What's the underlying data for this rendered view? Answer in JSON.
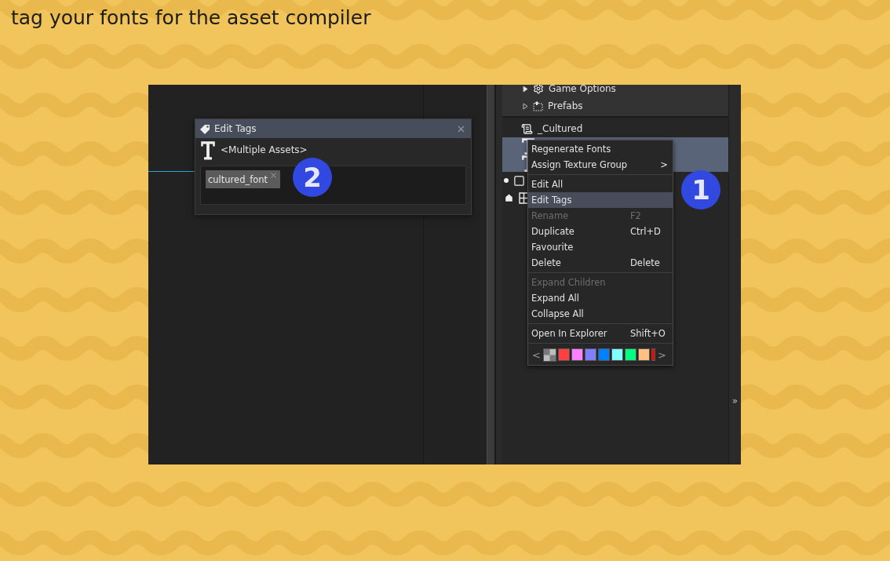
{
  "heading": "tag your fonts for the asset compiler",
  "tree": {
    "folders": [
      {
        "label": "Game Options",
        "expanded": false,
        "kind": "solid"
      },
      {
        "label": "Prefabs",
        "expanded": false,
        "kind": "outline"
      }
    ],
    "rows": [
      {
        "kind": "script",
        "label": "_Cultured",
        "selected": false
      },
      {
        "kind": "font",
        "selected": true
      },
      {
        "kind": "font",
        "selected": true
      },
      {
        "kind": "object",
        "selected": false
      },
      {
        "kind": "room",
        "selected": false
      }
    ]
  },
  "side_toggle": "»",
  "context_menu": {
    "items": [
      {
        "kind": "item",
        "label": "Regenerate Fonts",
        "disabled": false,
        "selected": false
      },
      {
        "kind": "item",
        "label": "Assign Texture Group",
        "submenu_arrow": ">",
        "disabled": false,
        "selected": false
      },
      {
        "kind": "separator"
      },
      {
        "kind": "item",
        "label": "Edit All",
        "disabled": false,
        "selected": false
      },
      {
        "kind": "item",
        "label": "Edit Tags",
        "disabled": false,
        "selected": true
      },
      {
        "kind": "item",
        "label": "Rename",
        "shortcut": "F2",
        "disabled": true,
        "selected": false
      },
      {
        "kind": "item",
        "label": "Duplicate",
        "shortcut": "Ctrl+D",
        "disabled": false,
        "selected": false
      },
      {
        "kind": "item",
        "label": "Favourite",
        "disabled": false,
        "selected": false
      },
      {
        "kind": "item",
        "label": "Delete",
        "shortcut": "Delete",
        "disabled": false,
        "selected": false
      },
      {
        "kind": "separator"
      },
      {
        "kind": "item",
        "label": "Expand Children",
        "disabled": true,
        "selected": false
      },
      {
        "kind": "item",
        "label": "Expand All",
        "disabled": false,
        "selected": false
      },
      {
        "kind": "item",
        "label": "Collapse All",
        "disabled": false,
        "selected": false
      },
      {
        "kind": "separator"
      },
      {
        "kind": "item",
        "label": "Open In Explorer",
        "shortcut": "Shift+O",
        "disabled": false,
        "selected": false
      },
      {
        "kind": "separator"
      },
      {
        "kind": "swatches",
        "prev": "<",
        "next": ">",
        "colors": [
          {
            "color": "#ff4040"
          },
          {
            "color": "#ff80ff"
          },
          {
            "color": "#8080ff"
          },
          {
            "color": "#0080ff"
          },
          {
            "color": "#80ffff"
          },
          {
            "color": "#00ff80"
          },
          {
            "color": "#ffc080"
          },
          {
            "color": "#ff0000"
          }
        ]
      }
    ]
  },
  "dialog": {
    "title": "Edit Tags",
    "asset": "<Multiple Assets>",
    "tags": [
      "cultured_font"
    ]
  },
  "badges": [
    {
      "number": "1"
    },
    {
      "number": "2"
    }
  ]
}
